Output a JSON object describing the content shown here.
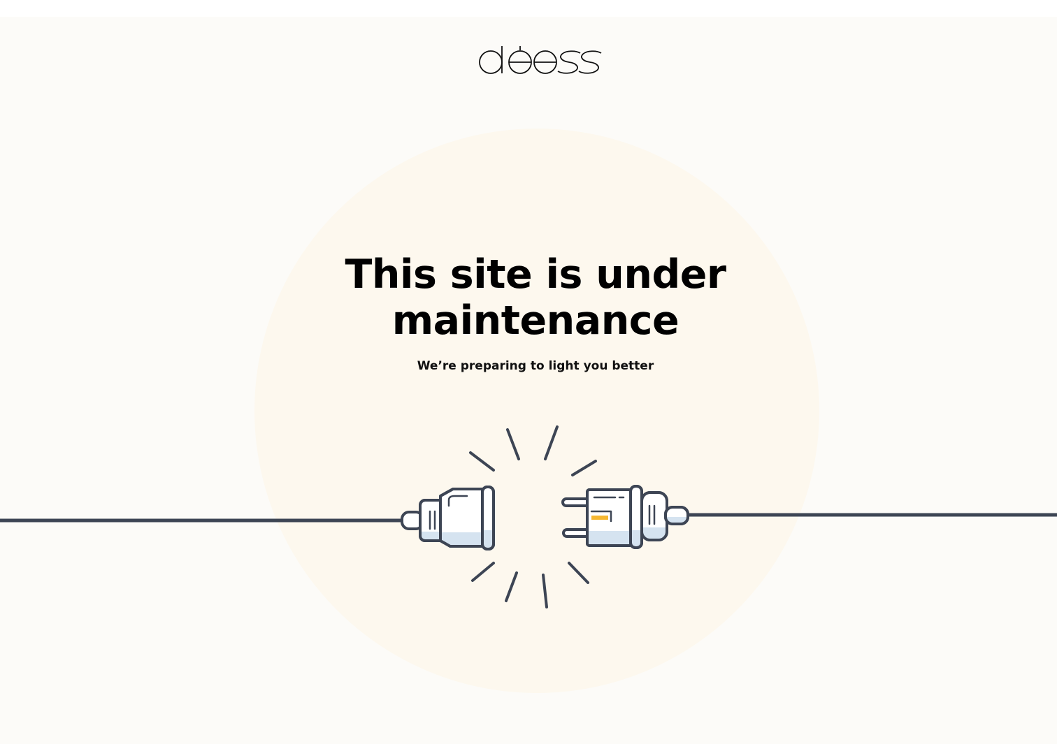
{
  "brand": {
    "logo_text": "déesse"
  },
  "maintenance": {
    "heading": "This site is under maintenance",
    "message": "We’re preparing to light you better"
  },
  "icons": {
    "illustration": "unplugged-cable-icon"
  },
  "colors": {
    "background": "#fcfbf8",
    "glow": "#fdf8ee",
    "line": "#3d4554",
    "plug_fill": "#ffffff",
    "plug_shade": "#d5e3f0",
    "accent": "#f5b731"
  }
}
